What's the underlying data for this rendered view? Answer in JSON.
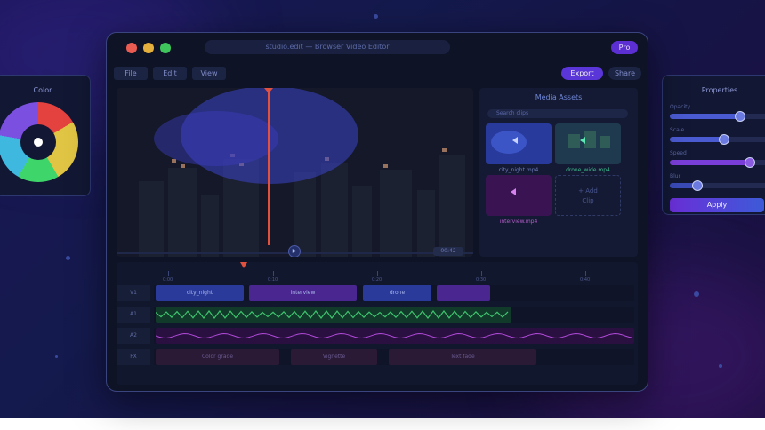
{
  "window": {
    "url": "studio.edit — Browser Video Editor",
    "badge": "Pro"
  },
  "menu": {
    "file": "File",
    "edit": "Edit",
    "view": "View",
    "export": "Export",
    "share": "Share"
  },
  "preview": {
    "timecode": "00:42",
    "play_glyph": "▶"
  },
  "assets": {
    "title": "Media Assets",
    "search_placeholder": "Search clips",
    "clips": [
      {
        "label": "city_night.mp4"
      },
      {
        "label": "drone_wide.mp4"
      },
      {
        "label": "interview.mp4"
      }
    ],
    "add_clip": "+ Add\nClip"
  },
  "timeline": {
    "ticks": [
      "0:00",
      "0:10",
      "0:20",
      "0:30",
      "0:40"
    ],
    "tracks": [
      {
        "label": "V1",
        "clips": [
          "city_night",
          "interview",
          "drone",
          ""
        ]
      },
      {
        "label": "A1"
      },
      {
        "label": "A2"
      },
      {
        "label": "FX",
        "clips": [
          "Color grade",
          "Vignette",
          "Text fade"
        ]
      }
    ]
  },
  "color_panel": {
    "title": "Color"
  },
  "properties_panel": {
    "title": "Properties",
    "sliders": [
      {
        "label": "Opacity",
        "value": 0.72
      },
      {
        "label": "Scale",
        "value": 0.55
      },
      {
        "label": "Speed",
        "value": 0.82
      },
      {
        "label": "Blur",
        "value": 0.28
      }
    ],
    "apply": "Apply"
  },
  "colors": {
    "accent": "#5a36d9",
    "playhead": "#e2503e",
    "wave_a1": "#3ec46e",
    "wave_a2": "#b04ad8"
  }
}
